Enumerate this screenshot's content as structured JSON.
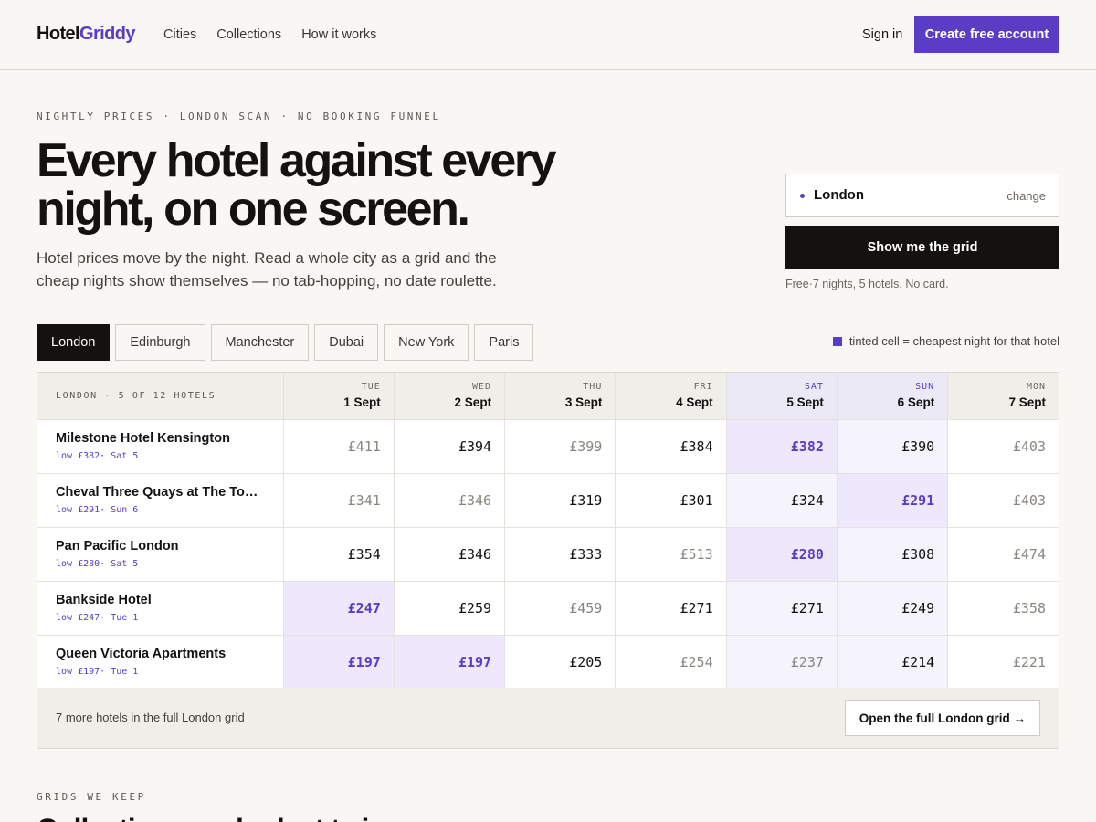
{
  "header": {
    "logo_a": "Hotel",
    "logo_b": "Griddy",
    "nav": [
      "Cities",
      "Collections",
      "How it works"
    ],
    "sign_in": "Sign in",
    "cta": "Create free account"
  },
  "hero": {
    "eyebrow": "NIGHTLY PRICES · LONDON SCAN · NO BOOKING FUNNEL",
    "title_1": "Every hotel against every",
    "title_2": "night, on one screen.",
    "sub_1": "Hotel prices move by the night. Read a whole city as a grid and the",
    "sub_2": "cheap nights show themselves — no tab-hopping, no date roulette."
  },
  "search": {
    "city": "London",
    "change": "change",
    "button": "Show me the grid",
    "note": "Free·7 nights, 5 hotels. No card."
  },
  "cities": {
    "tabs": [
      "London",
      "Edinburgh",
      "Manchester",
      "Dubai",
      "New York",
      "Paris"
    ],
    "active": 0,
    "legend": "tinted cell = cheapest night for that hotel"
  },
  "grid": {
    "corner": "LONDON · 5 OF 12 HOTELS",
    "days": [
      {
        "dow": "TUE",
        "date": "1 Sept",
        "weekend": false
      },
      {
        "dow": "WED",
        "date": "2 Sept",
        "weekend": false
      },
      {
        "dow": "THU",
        "date": "3 Sept",
        "weekend": false
      },
      {
        "dow": "FRI",
        "date": "4 Sept",
        "weekend": false
      },
      {
        "dow": "SAT",
        "date": "5 Sept",
        "weekend": true
      },
      {
        "dow": "SUN",
        "date": "6 Sept",
        "weekend": true
      },
      {
        "dow": "MON",
        "date": "7 Sept",
        "weekend": false
      }
    ],
    "hotels": [
      {
        "name": "Milestone Hotel Kensington",
        "low": "low £382· Sat 5",
        "prices": [
          "£411",
          "£394",
          "£399",
          "£384",
          "£382",
          "£390",
          "£403"
        ],
        "dim": [
          true,
          false,
          true,
          false,
          false,
          false,
          true
        ],
        "low_idx": [
          4
        ]
      },
      {
        "name": "Cheval Three Quays at The Tower…",
        "low": "low £291· Sun 6",
        "prices": [
          "£341",
          "£346",
          "£319",
          "£301",
          "£324",
          "£291",
          "£403"
        ],
        "dim": [
          true,
          true,
          false,
          false,
          false,
          false,
          true
        ],
        "low_idx": [
          5
        ]
      },
      {
        "name": "Pan Pacific London",
        "low": "low £280· Sat 5",
        "prices": [
          "£354",
          "£346",
          "£333",
          "£513",
          "£280",
          "£308",
          "£474"
        ],
        "dim": [
          false,
          false,
          false,
          true,
          false,
          false,
          true
        ],
        "low_idx": [
          4
        ]
      },
      {
        "name": "Bankside Hotel",
        "low": "low £247· Tue 1",
        "prices": [
          "£247",
          "£259",
          "£459",
          "£271",
          "£271",
          "£249",
          "£358"
        ],
        "dim": [
          false,
          false,
          true,
          false,
          false,
          false,
          true
        ],
        "low_idx": [
          0
        ]
      },
      {
        "name": "Queen Victoria Apartments",
        "low": "low £197· Tue 1",
        "prices": [
          "£197",
          "£197",
          "£205",
          "£254",
          "£237",
          "£214",
          "£221"
        ],
        "dim": [
          false,
          false,
          false,
          true,
          true,
          false,
          true
        ],
        "low_idx": [
          0,
          1
        ]
      }
    ],
    "more": "7 more hotels in the full London grid",
    "open": "Open the full London grid →"
  },
  "grids_section": {
    "eyebrow": "GRIDS WE KEEP",
    "title": "Collections we look at twice"
  }
}
